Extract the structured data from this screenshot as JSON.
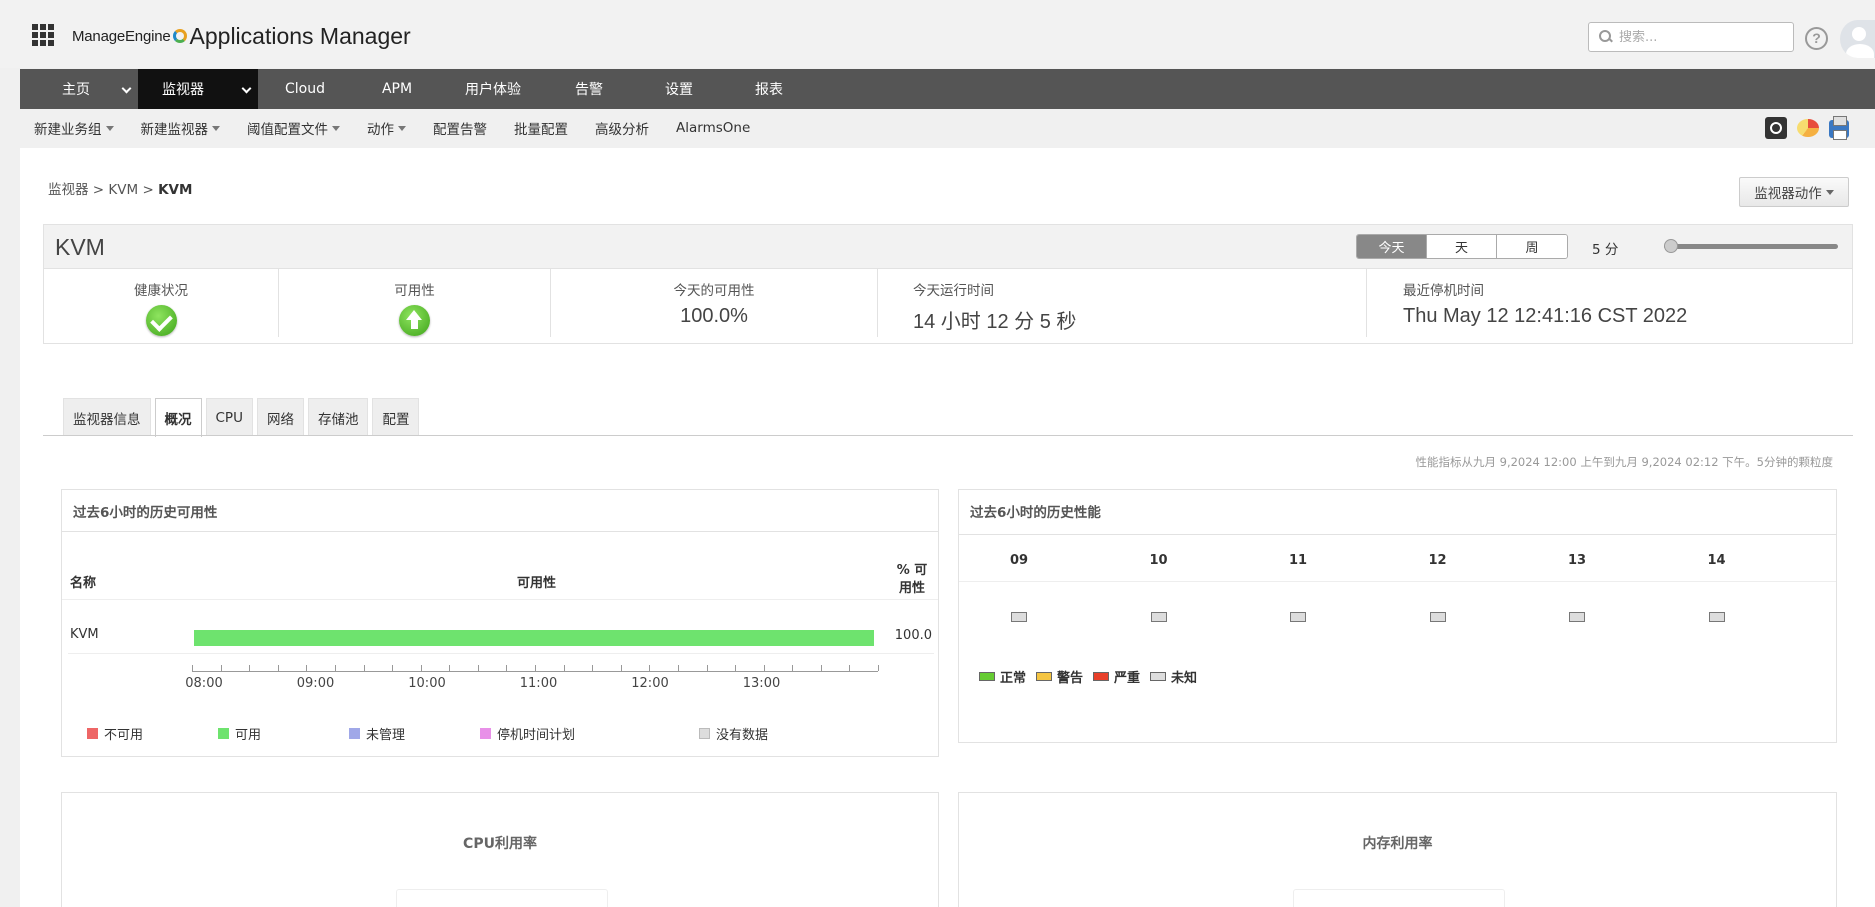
{
  "header": {
    "brand_small": "ManageEngine",
    "brand_large": "Applications Manager",
    "search_placeholder": "搜索...",
    "help_symbol": "?"
  },
  "nav": {
    "items": [
      {
        "label": "主页",
        "active": false,
        "dropdown": true
      },
      {
        "label": "监视器",
        "active": true,
        "dropdown": true
      },
      {
        "label": "Cloud",
        "active": false,
        "dropdown": false
      },
      {
        "label": "APM",
        "active": false,
        "dropdown": false
      },
      {
        "label": "用户体验",
        "active": false,
        "dropdown": false
      },
      {
        "label": "告警",
        "active": false,
        "dropdown": false
      },
      {
        "label": "设置",
        "active": false,
        "dropdown": false
      },
      {
        "label": "报表",
        "active": false,
        "dropdown": false
      }
    ]
  },
  "subbar": {
    "items": [
      {
        "label": "新建业务组",
        "dropdown": true
      },
      {
        "label": "新建监视器",
        "dropdown": true
      },
      {
        "label": "阈值配置文件",
        "dropdown": true
      },
      {
        "label": "动作",
        "dropdown": true
      },
      {
        "label": "配置告警",
        "dropdown": false
      },
      {
        "label": "批量配置",
        "dropdown": false
      },
      {
        "label": "高级分析",
        "dropdown": false
      },
      {
        "label": "AlarmsOne",
        "dropdown": false
      }
    ],
    "icons": [
      "camera-icon",
      "pie-chart-icon",
      "print-icon"
    ]
  },
  "breadcrumb": {
    "root": "监视器",
    "sep": ">",
    "type": "KVM",
    "current": "KVM"
  },
  "monitor_action_label": "监视器动作",
  "summary": {
    "title": "KVM",
    "periods": [
      {
        "label": "今天",
        "active": true
      },
      {
        "label": "天",
        "active": false
      },
      {
        "label": "周",
        "active": false
      }
    ],
    "interval": "5 分",
    "health_label": "健康状况",
    "health_status": "ok",
    "availability_label": "可用性",
    "availability_status": "up",
    "today_availability_label": "今天的可用性",
    "today_availability_value": "100.0%",
    "uptime_label": "今天运行时间",
    "uptime_value": "14 小时 12 分 5 秒",
    "last_down_label": "最近停机时间",
    "last_down_value": "Thu May 12 12:41:16 CST 2022"
  },
  "tabs": [
    {
      "label": "监视器信息",
      "active": false
    },
    {
      "label": "概况",
      "active": true
    },
    {
      "label": "CPU",
      "active": false
    },
    {
      "label": "网络",
      "active": false
    },
    {
      "label": "存储池",
      "active": false
    },
    {
      "label": "配置",
      "active": false
    }
  ],
  "perf_note": "性能指标从九月 9,2024 12:00 上午到九月 9,2024 02:12 下午。5分钟的颗粒度",
  "availability_history": {
    "title": "过去6小时的历史可用性",
    "col_name": "名称",
    "col_availability": "可用性",
    "col_pct_line1": "% 可",
    "col_pct_line2": "用性",
    "row_name": "KVM",
    "row_availability_pct": 100,
    "row_pct_text": "100.0",
    "axis_ticks": [
      "08:00",
      "09:00",
      "10:00",
      "11:00",
      "12:00",
      "13:00"
    ],
    "legend": [
      {
        "label": "不可用",
        "color": "#ee6666"
      },
      {
        "label": "可用",
        "color": "#6ee36e"
      },
      {
        "label": "未管理",
        "color": "#a0a8e8"
      },
      {
        "label": "停机时间计划",
        "color": "#e890e8"
      },
      {
        "label": "没有数据",
        "color": "#dddddd"
      }
    ]
  },
  "performance_history": {
    "title": "过去6小时的历史性能",
    "hours": [
      "09",
      "10",
      "11",
      "12",
      "13",
      "14"
    ],
    "legend": [
      {
        "label": "正常",
        "color": "#66cc33"
      },
      {
        "label": "警告",
        "color": "#f5c542"
      },
      {
        "label": "严重",
        "color": "#e8402a"
      },
      {
        "label": "未知",
        "color": "#dddddd"
      }
    ]
  },
  "cpu_title": "CPU利用率",
  "mem_title": "内存利用率",
  "colors": {
    "nav_bg": "#555555",
    "nav_active": "#111111",
    "available_green": "#6ee36e"
  }
}
